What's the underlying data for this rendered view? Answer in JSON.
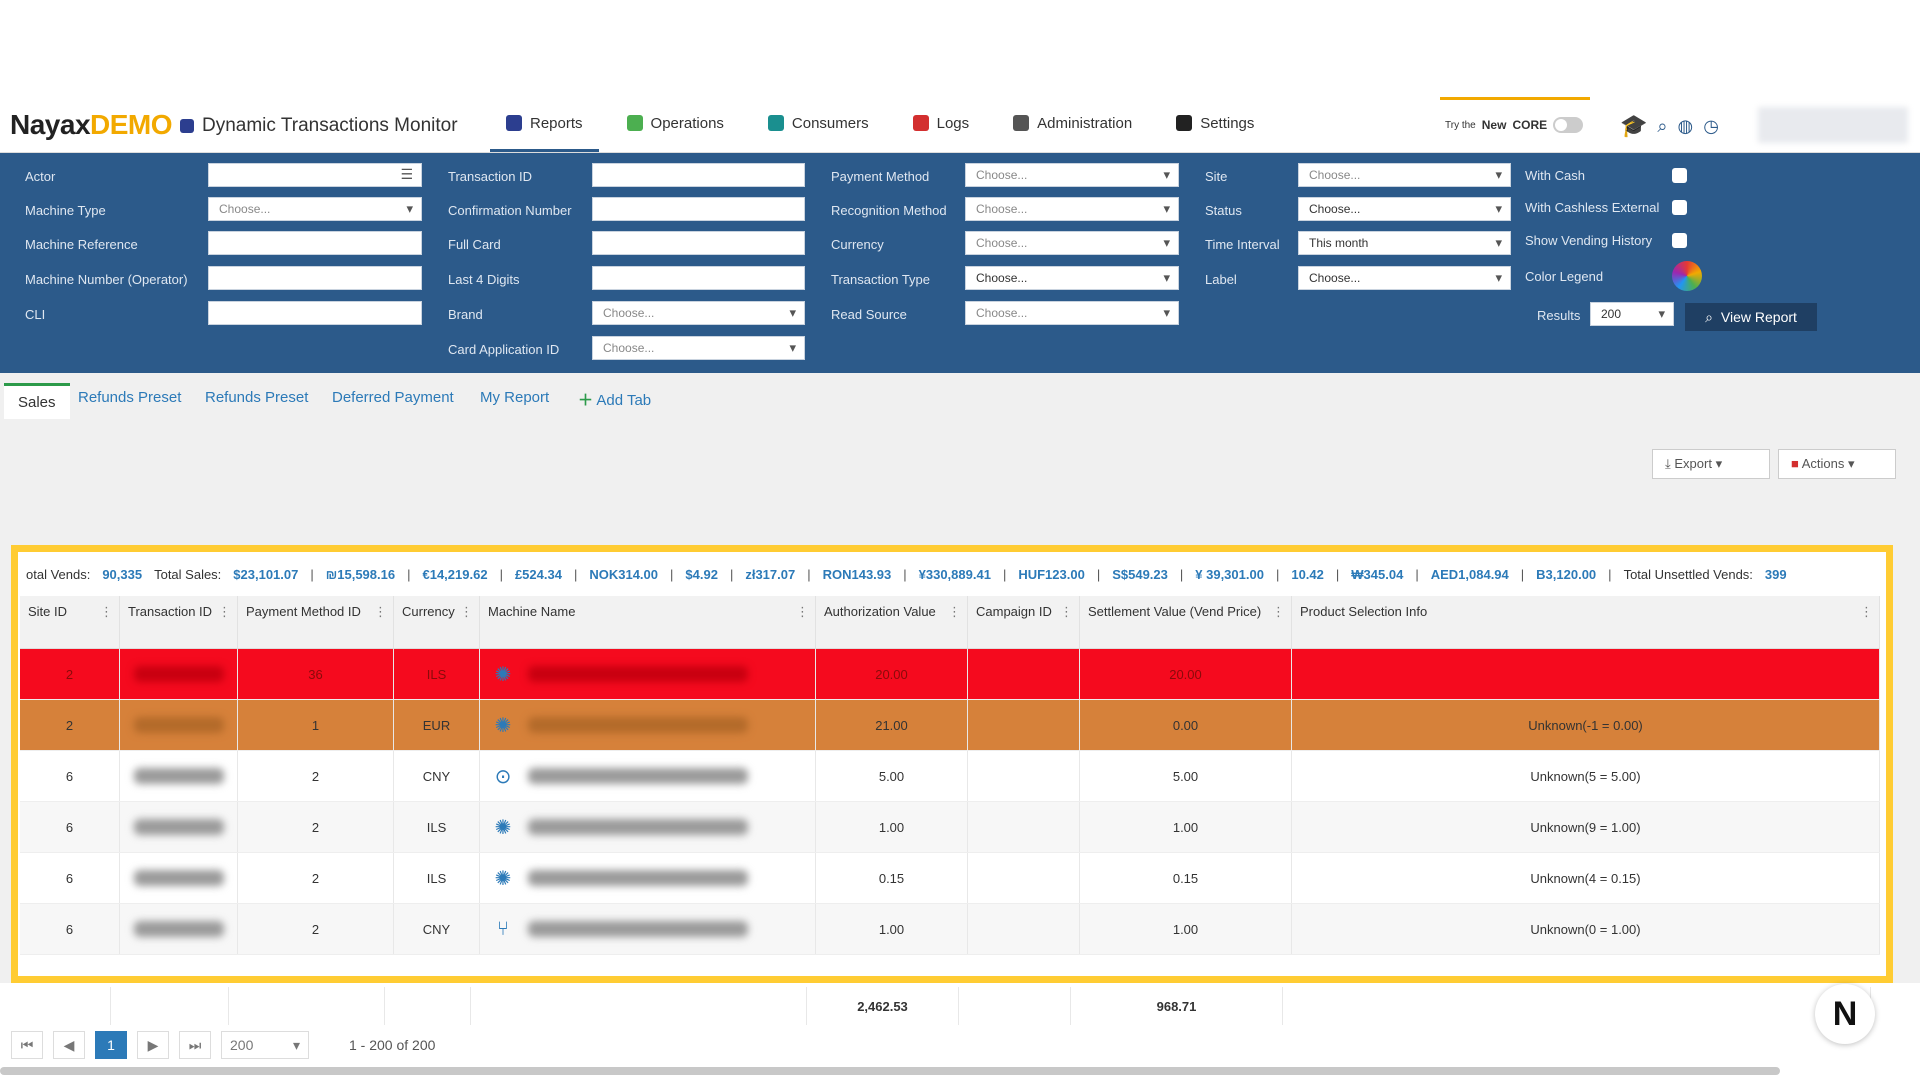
{
  "header": {
    "brand": "Nayax",
    "brand_suffix": "DEMO",
    "title": "Dynamic Transactions Monitor",
    "nav": [
      {
        "label": "Reports",
        "icon": "chart-icon",
        "color": "#2c3e8f"
      },
      {
        "label": "Operations",
        "icon": "operations-icon",
        "color": "#4caf50"
      },
      {
        "label": "Consumers",
        "icon": "consumers-icon",
        "color": "#1a8f8f"
      },
      {
        "label": "Logs",
        "icon": "logs-icon",
        "color": "#d32f2f"
      },
      {
        "label": "Administration",
        "icon": "admin-icon",
        "color": "#555555"
      },
      {
        "label": "Settings",
        "icon": "gear-icon",
        "color": "#222222"
      }
    ],
    "try_prefix": "Try the",
    "try_new": "New",
    "try_core": "CORE"
  },
  "filters": {
    "actor": "Actor",
    "machine_type": "Machine Type",
    "machine_reference": "Machine Reference",
    "machine_number": "Machine Number (Operator)",
    "cli": "CLI",
    "transaction_id": "Transaction ID",
    "confirmation_number": "Confirmation Number",
    "full_card": "Full Card",
    "last4": "Last 4 Digits",
    "brand": "Brand",
    "card_app_id": "Card Application ID",
    "payment_method": "Payment Method",
    "recognition_method": "Recognition Method",
    "currency": "Currency",
    "transaction_type": "Transaction Type",
    "read_source": "Read Source",
    "site": "Site",
    "status": "Status",
    "time_interval": "Time Interval",
    "label": "Label",
    "with_cash": "With Cash",
    "with_cashless": "With Cashless External",
    "show_vending": "Show Vending History",
    "color_legend": "Color Legend",
    "results": "Results",
    "choose": "Choose...",
    "time_interval_value": "This month",
    "results_value": "200",
    "view_report": "View Report"
  },
  "tabs": [
    "Sales",
    "Refunds Preset",
    "Refunds Preset",
    "Deferred Payment",
    "My Report"
  ],
  "add_tab": "Add Tab",
  "toolbar": {
    "export": "Export",
    "actions": "Actions"
  },
  "summary": {
    "total_vends_label": "otal Vends:",
    "total_vends": "90,335",
    "total_sales_label": "Total Sales:",
    "amounts": [
      "$23,101.07",
      "₪15,598.16",
      "€14,219.62",
      "£524.34",
      "NOK314.00",
      "$4.92",
      "zł317.07",
      "RON143.93",
      "¥330,889.41",
      "HUF123.00",
      "S$549.23",
      "¥ 39,301.00",
      "10.42",
      "₩345.04",
      "AED1,084.94",
      "B3,120.00"
    ],
    "unsettled_label": "Total Unsettled Vends:",
    "unsettled": "399"
  },
  "grid": {
    "columns": [
      "Site ID",
      "Transaction ID",
      "Payment Method ID",
      "Currency",
      "Machine Name",
      "Authorization Value",
      "Campaign ID",
      "Settlement Value (Vend Price)",
      "Product Selection Info"
    ],
    "rows": [
      {
        "site": "2",
        "pm": "36",
        "cur": "ILS",
        "auth": "20.00",
        "camp": "",
        "settle": "20.00",
        "prod": "",
        "style": "red"
      },
      {
        "site": "2",
        "pm": "1",
        "cur": "EUR",
        "auth": "21.00",
        "camp": "",
        "settle": "0.00",
        "prod": "Unknown(-1 = 0.00)",
        "style": "orange"
      },
      {
        "site": "6",
        "pm": "2",
        "cur": "CNY",
        "auth": "5.00",
        "camp": "",
        "settle": "5.00",
        "prod": "Unknown(5 = 5.00)",
        "style": "white"
      },
      {
        "site": "6",
        "pm": "2",
        "cur": "ILS",
        "auth": "1.00",
        "camp": "",
        "settle": "1.00",
        "prod": "Unknown(9 = 1.00)",
        "style": "alt"
      },
      {
        "site": "6",
        "pm": "2",
        "cur": "ILS",
        "auth": "0.15",
        "camp": "",
        "settle": "0.15",
        "prod": "Unknown(4 = 0.15)",
        "style": "white"
      },
      {
        "site": "6",
        "pm": "2",
        "cur": "CNY",
        "auth": "1.00",
        "camp": "",
        "settle": "1.00",
        "prod": "Unknown(0 = 1.00)",
        "style": "alt"
      }
    ]
  },
  "totals": {
    "auth": "2,462.53",
    "settle": "968.71"
  },
  "pager": {
    "page": "1",
    "page_size": "200",
    "range": "1 - 200 of 200"
  }
}
